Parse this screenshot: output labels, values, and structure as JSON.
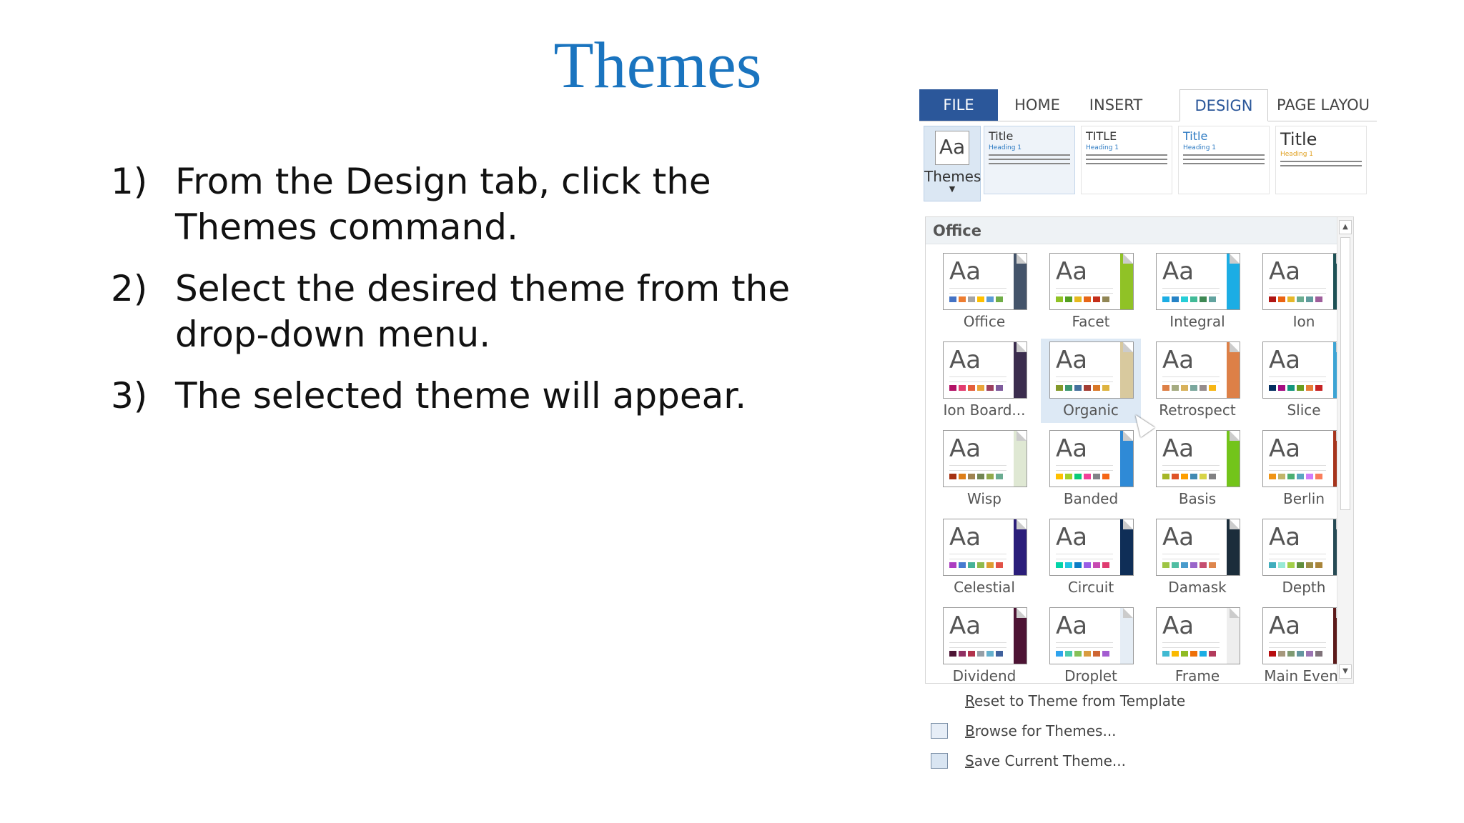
{
  "slide": {
    "title": "Themes",
    "steps": [
      {
        "num": "1)",
        "text": "From the Design tab, click the Themes command."
      },
      {
        "num": "2)",
        "text": "Select the desired theme from the drop-down menu."
      },
      {
        "num": "3)",
        "text": "The selected theme will appear."
      }
    ]
  },
  "ribbon": {
    "tabs": [
      "FILE",
      "HOME",
      "INSERT",
      "DESIGN",
      "PAGE LAYOU"
    ],
    "active_tab": "DESIGN",
    "themes_button": {
      "icon_text": "Aa",
      "label": "Themes"
    },
    "style_previews": [
      {
        "title": "Title",
        "heading": "Heading 1"
      },
      {
        "title": "TITLE",
        "heading": "Heading 1"
      },
      {
        "title": "Title",
        "heading": "Heading 1"
      },
      {
        "title": "Title",
        "heading": "Heading 1"
      }
    ]
  },
  "gallery": {
    "section_label": "Office",
    "themes": [
      {
        "name": "Office",
        "aa": "Aa",
        "accent": "#44546a",
        "swatches": [
          "#4472c4",
          "#ed7d31",
          "#a5a5a5",
          "#ffc000",
          "#5b9bd5",
          "#70ad47"
        ]
      },
      {
        "name": "Facet",
        "aa": "Aa",
        "accent": "#90c226",
        "swatches": [
          "#90c226",
          "#54a021",
          "#e6b91e",
          "#e76618",
          "#c42f1a",
          "#918655"
        ]
      },
      {
        "name": "Integral",
        "aa": "Aa",
        "accent": "#1cade4",
        "swatches": [
          "#1cade4",
          "#2683c6",
          "#27ced7",
          "#42ba97",
          "#3e8853",
          "#62a39f"
        ]
      },
      {
        "name": "Ion",
        "aa": "Aa",
        "accent": "#1e5155",
        "swatches": [
          "#b01513",
          "#ea6312",
          "#e6b729",
          "#6aac90",
          "#5f9c9d",
          "#9e5e9b"
        ]
      },
      {
        "name": "Ion Board...",
        "aa": "Aa",
        "accent": "#3b2d4e",
        "swatches": [
          "#b31166",
          "#e33d6f",
          "#e45f3c",
          "#e9a43a",
          "#9c3f5f",
          "#7e5b9c"
        ]
      },
      {
        "name": "Organic",
        "aa": "Aa",
        "accent": "#d8c99e",
        "swatches": [
          "#83992a",
          "#3c9770",
          "#44709d",
          "#a23c33",
          "#d97828",
          "#deb340"
        ]
      },
      {
        "name": "Retrospect",
        "aa": "Aa",
        "accent": "#dd8047",
        "swatches": [
          "#dd8047",
          "#a5ab81",
          "#d8b25c",
          "#7ba79d",
          "#968c8c",
          "#f7b615"
        ]
      },
      {
        "name": "Slice",
        "aa": "Aa",
        "accent": "#3da4d4",
        "swatches": [
          "#052f61",
          "#a50e82",
          "#14967c",
          "#6a9e1f",
          "#e87d37",
          "#c62324"
        ]
      },
      {
        "name": "Wisp",
        "aa": "Aa",
        "accent": "#dfe8d3",
        "swatches": [
          "#a53010",
          "#de7e18",
          "#9f8351",
          "#728653",
          "#92aa4c",
          "#6aac91"
        ]
      },
      {
        "name": "Banded",
        "aa": "Aa",
        "accent": "#2f8ad6",
        "swatches": [
          "#ffc000",
          "#a5d028",
          "#08cc78",
          "#f24099",
          "#828288",
          "#f56617"
        ]
      },
      {
        "name": "Basis",
        "aa": "Aa",
        "accent": "#73c41a",
        "swatches": [
          "#a6b727",
          "#df5327",
          "#fe9e00",
          "#418ab3",
          "#d7d447",
          "#818183"
        ]
      },
      {
        "name": "Berlin",
        "aa": "Aa",
        "accent": "#a6341c",
        "swatches": [
          "#f09415",
          "#c1b56b",
          "#4baf73",
          "#5aa6c0",
          "#d17df9",
          "#fa7e5c"
        ]
      },
      {
        "name": "Celestial",
        "aa": "Aa",
        "accent": "#2b1e7a",
        "swatches": [
          "#ac3ec1",
          "#477bd1",
          "#46b298",
          "#90ba4c",
          "#dd9d31",
          "#e25247"
        ]
      },
      {
        "name": "Circuit",
        "aa": "Aa",
        "accent": "#0f2e57",
        "swatches": [
          "#03d4a8",
          "#21c5e1",
          "#0b7dc6",
          "#9b5ee6",
          "#c84bb3",
          "#e03c71"
        ]
      },
      {
        "name": "Damask",
        "aa": "Aa",
        "accent": "#1b2d3b",
        "swatches": [
          "#9ec544",
          "#50bea3",
          "#4a9ccc",
          "#9a66ca",
          "#c54f71",
          "#de864d"
        ]
      },
      {
        "name": "Depth",
        "aa": "Aa",
        "accent": "#264a54",
        "swatches": [
          "#41aebd",
          "#97e9d5",
          "#a2cf49",
          "#608f3d",
          "#9c8d46",
          "#a9853a"
        ]
      },
      {
        "name": "Dividend",
        "aa": "Aa",
        "accent": "#4d1434",
        "swatches": [
          "#4d1434",
          "#903163",
          "#b2324b",
          "#969fa7",
          "#66b1ce",
          "#40619d"
        ]
      },
      {
        "name": "Droplet",
        "aa": "Aa",
        "accent": "#e5edf5",
        "swatches": [
          "#2fa3ee",
          "#4bcaad",
          "#86c157",
          "#d99c3f",
          "#ce6633",
          "#a35dd1"
        ]
      },
      {
        "name": "Frame",
        "aa": "Aa",
        "accent": "#eeeeee",
        "swatches": [
          "#40bad2",
          "#fab900",
          "#90bb23",
          "#ee7008",
          "#1cade4",
          "#b33b5c"
        ]
      },
      {
        "name": "Main Event",
        "aa": "Aa",
        "accent": "#5c1a1a",
        "swatches": [
          "#b80e0f",
          "#a6987d",
          "#7f9a71",
          "#64969f",
          "#9b75b2",
          "#80737a"
        ]
      }
    ]
  },
  "menu": {
    "items": [
      {
        "label": "Reset to Theme from Template",
        "icon": "none"
      },
      {
        "label": "Browse for Themes...",
        "icon": "folder-icon"
      },
      {
        "label": "Save Current Theme...",
        "icon": "save-icon"
      }
    ]
  }
}
